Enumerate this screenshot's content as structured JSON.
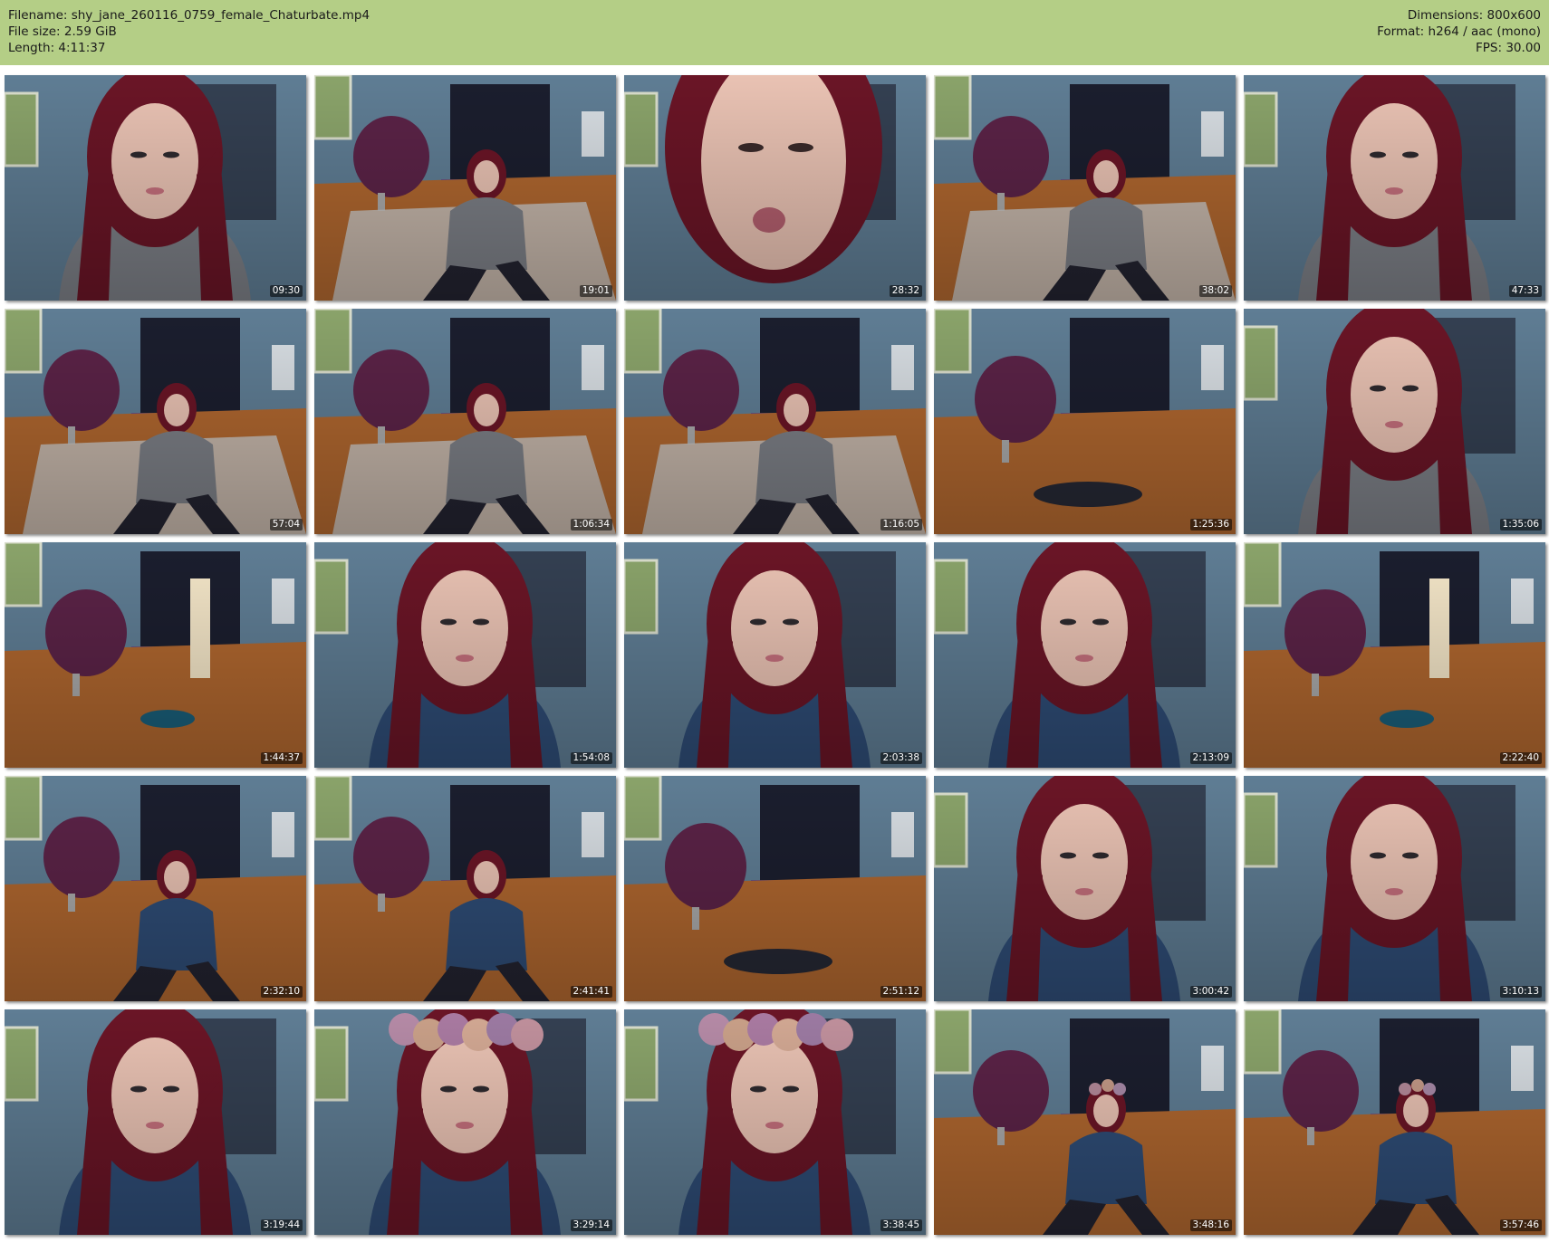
{
  "header": {
    "filename_label": "Filename: shy_jane_260116_0759_female_Chaturbate.mp4",
    "filesize_label": "File size: 2.59 GiB",
    "length_label": "Length: 4:11:37",
    "dimensions_label": "Dimensions: 800x600",
    "format_label": "Format: h264 / aac (mono)",
    "fps_label": "FPS: 30.00"
  },
  "thumbnails": [
    {
      "timestamp": "09:30",
      "scene": "face"
    },
    {
      "timestamp": "19:01",
      "scene": "floor"
    },
    {
      "timestamp": "28:32",
      "scene": "closeup"
    },
    {
      "timestamp": "38:02",
      "scene": "floor"
    },
    {
      "timestamp": "47:33",
      "scene": "face"
    },
    {
      "timestamp": "57:04",
      "scene": "floor"
    },
    {
      "timestamp": "1:06:34",
      "scene": "floor"
    },
    {
      "timestamp": "1:16:05",
      "scene": "floor"
    },
    {
      "timestamp": "1:25:36",
      "scene": "room"
    },
    {
      "timestamp": "1:35:06",
      "scene": "face"
    },
    {
      "timestamp": "1:44:37",
      "scene": "room-door"
    },
    {
      "timestamp": "1:54:08",
      "scene": "face-denim"
    },
    {
      "timestamp": "2:03:38",
      "scene": "face-denim"
    },
    {
      "timestamp": "2:13:09",
      "scene": "face-denim"
    },
    {
      "timestamp": "2:22:40",
      "scene": "room-door"
    },
    {
      "timestamp": "2:32:10",
      "scene": "floor-denim"
    },
    {
      "timestamp": "2:41:41",
      "scene": "floor-denim"
    },
    {
      "timestamp": "2:51:12",
      "scene": "room"
    },
    {
      "timestamp": "3:00:42",
      "scene": "face-denim"
    },
    {
      "timestamp": "3:10:13",
      "scene": "face-denim"
    },
    {
      "timestamp": "3:19:44",
      "scene": "face-denim"
    },
    {
      "timestamp": "3:29:14",
      "scene": "flower-crown"
    },
    {
      "timestamp": "3:38:45",
      "scene": "flower-crown"
    },
    {
      "timestamp": "3:48:16",
      "scene": "floor-crown"
    },
    {
      "timestamp": "3:57:46",
      "scene": "floor-crown"
    }
  ],
  "colors": {
    "header_bg": "#b4ce86",
    "wall": "#5f7d94",
    "floor": "#b0672f",
    "hair": "#6a1526",
    "chair": "#5b2347"
  }
}
